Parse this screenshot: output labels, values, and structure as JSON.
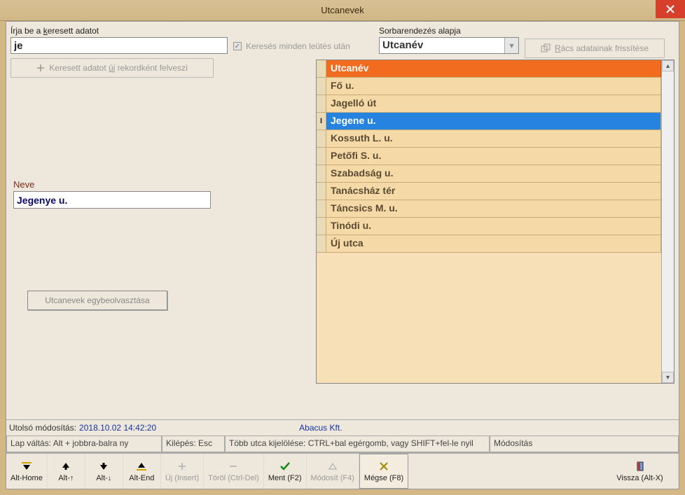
{
  "window": {
    "title": "Utcanevek"
  },
  "search": {
    "label_html": "Írja be a keresett adatot",
    "value": "je",
    "felvesz_label": "Keresett adatot új rekordként felveszi"
  },
  "search_chk": {
    "label": "Keresés minden leütés után"
  },
  "sort": {
    "label": "Sorbarendezés alapja",
    "value": "Utcanév"
  },
  "refresh": {
    "label": "Rács adatainak frissítése"
  },
  "neve": {
    "label": "Neve",
    "value": "Jegenye u."
  },
  "merge": {
    "label": "Utcanevek egybeolvasztása"
  },
  "grid": {
    "header": "Utcanév",
    "rows": [
      {
        "name": "Fő u."
      },
      {
        "name": "Jagelló út"
      },
      {
        "name": "Jegene u.",
        "selected": true
      },
      {
        "name": "Kossuth L. u."
      },
      {
        "name": "Petőfi S. u."
      },
      {
        "name": "Szabadság u."
      },
      {
        "name": "Tanácsház tér"
      },
      {
        "name": "Táncsics M. u."
      },
      {
        "name": "Tinódi u."
      },
      {
        "name": "Új utca"
      }
    ]
  },
  "status": {
    "mod_label": "Utolsó módosítás:",
    "mod_value": "2018.10.02 14:42:20",
    "company": "Abacus Kft.",
    "seg1": "Lap váltás: Alt + jobbra-balra ny",
    "seg2": "Kilépés: Esc",
    "seg3": "Több utca kijelölése: CTRL+bal egérgomb, vagy SHIFT+fel-le nyil",
    "seg4": "Módosítás"
  },
  "toolbar": {
    "alt_home": "Alt-Home",
    "alt_up": "Alt-↑",
    "alt_down": "Alt-↓",
    "alt_end": "Alt-End",
    "uj": "Új (Insert)",
    "torol": "Töröl (Ctrl-Del)",
    "ment": "Ment (F2)",
    "modosit": "Módosít (F4)",
    "megse": "Mégse (F8)",
    "vissza": "Vissza (Alt-X)"
  }
}
